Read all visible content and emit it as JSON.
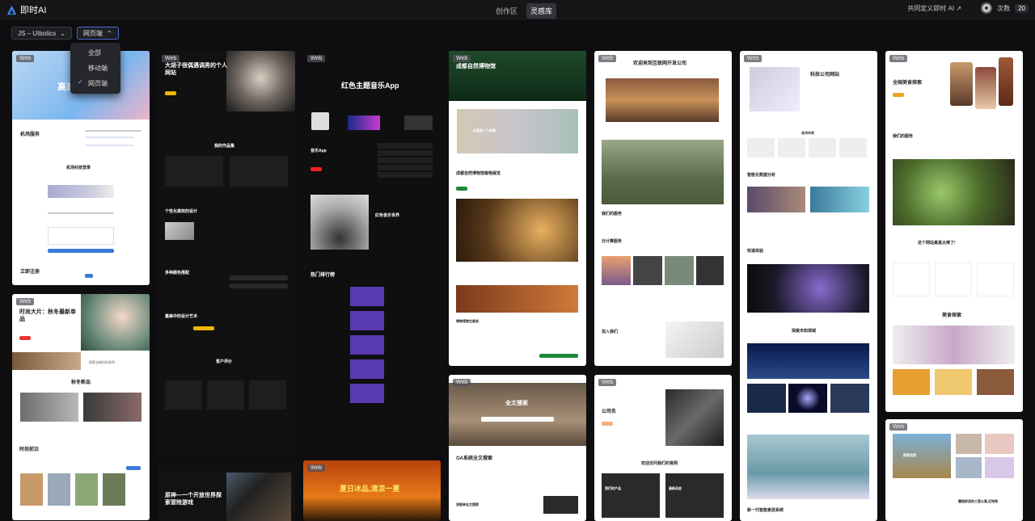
{
  "app": {
    "name": "即时AI",
    "nav": [
      "创作区",
      "灵感库"
    ],
    "active_nav": 1,
    "share": "共同定义即时 AI ↗",
    "credits_label": "次数",
    "credits": "20"
  },
  "filters": {
    "language": "JS – UIbotics",
    "type": "网页端",
    "options": [
      "全部",
      "移动端",
      "网页端"
    ],
    "selected": 2
  },
  "cards": [
    {
      "tag": "Web",
      "title": "高速",
      "h1": "机场服务",
      "h2": "机场科技登录",
      "h3": "立即注册"
    },
    {
      "tag": "Web",
      "title": "时尚大片：秋冬最新单品",
      "h1": "秋冬新品",
      "h2": "时尚前沿",
      "sub": "探索全新时尚系列"
    },
    {
      "tag": "Web",
      "title": "大胡子很偶遇调男的个人网站",
      "h1": "我的作品集",
      "h2": "个性化高效的设计",
      "h3": "多种颜色搭配",
      "h4": "最美中的设计艺术",
      "h5": "客户评价"
    },
    {
      "tag": "Web",
      "title": "原神—一个开放世界探索冒险游戏"
    },
    {
      "tag": "Web",
      "title": "红色主题音乐App",
      "h1": "音乐App",
      "h2": "红色音乐世界",
      "h3": "热门排行榜"
    },
    {
      "tag": "Web",
      "title": "夏日冰品,清凉一夏"
    },
    {
      "tag": "Web",
      "title": "成都自然博物馆",
      "h1": "成都自然博物馆植物展览",
      "h2": "博物馆物生展览",
      "hero": "这里是一个标题"
    },
    {
      "tag": "Web",
      "title": "全文搜索",
      "h1": "OA系统全文搜索",
      "h2": "流程单全文搜索"
    },
    {
      "tag": "Web",
      "title": "欢迎来到互联网开发公司",
      "h1": "我们的服务",
      "h2": "云计算服务",
      "h3": "加入我们"
    },
    {
      "tag": "Web",
      "title": "公司名",
      "h1": "欢迎访问我们的官网",
      "h2": "我们的产品",
      "h3": "最新动态"
    },
    {
      "tag": "Web",
      "title": "科技公司网站",
      "h1": "合作伙伴",
      "h2": "智能化数据分析",
      "h3": "快速体验",
      "h4": "探索未知领域",
      "h5": "新一代智能家居系统"
    },
    {
      "tag": "Web",
      "title": "全国美食探索",
      "h1": "我们的服务",
      "h2": "这个网站真是太棒了!",
      "h3": "美食探索"
    },
    {
      "tag": "Web",
      "title": "探索自然",
      "h1": "體验舒适的三室公寓,近地铁"
    }
  ]
}
